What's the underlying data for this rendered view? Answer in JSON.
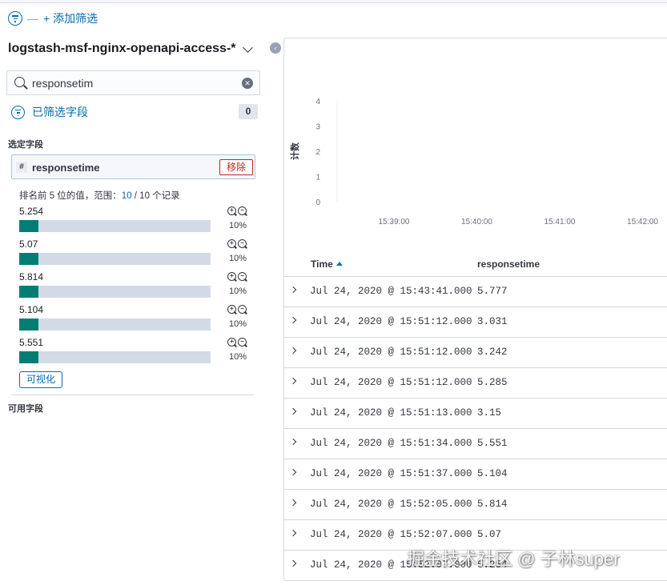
{
  "filter_bar": {
    "separator": "—",
    "add_filter": "+ 添加筛选"
  },
  "sidebar": {
    "index_pattern": "logstash-msf-nginx-openapi-access-*",
    "collapse_glyph": "‹",
    "search": {
      "value": "responsetim",
      "placeholder": ""
    },
    "filtered_fields_label": "已筛选字段",
    "filtered_fields_count": "0",
    "selected_fields_title": "选定字段",
    "available_fields_title": "可用字段",
    "selected_field": {
      "type_glyph": "#",
      "name": "responsetime",
      "remove_label": "移除",
      "details": {
        "summary_prefix": "排名前 5 位的值，范围：",
        "summary_count": "10",
        "summary_suffix": " / 10 个记录",
        "top_values": [
          {
            "value": "5.254",
            "percent": "10%",
            "fraction": 0.1
          },
          {
            "value": "5.07",
            "percent": "10%",
            "fraction": 0.1
          },
          {
            "value": "5.814",
            "percent": "10%",
            "fraction": 0.1
          },
          {
            "value": "5.104",
            "percent": "10%",
            "fraction": 0.1
          },
          {
            "value": "5.551",
            "percent": "10%",
            "fraction": 0.1
          }
        ],
        "visualize_label": "可视化"
      }
    }
  },
  "chart_data": {
    "type": "bar",
    "ylabel": "计数",
    "ylim": [
      0,
      4
    ],
    "y_ticks": [
      "0",
      "1",
      "2",
      "3",
      "4"
    ],
    "x_ticks": [
      "15:39:00",
      "15:40:00",
      "15:41:00",
      "15:42:00"
    ],
    "grid": false
  },
  "documents": {
    "columns": [
      "Time",
      "responsetime"
    ],
    "rows": [
      {
        "time": "Jul 24, 2020 @ 15:43:41.000",
        "responsetime": "5.777"
      },
      {
        "time": "Jul 24, 2020 @ 15:51:12.000",
        "responsetime": "3.031"
      },
      {
        "time": "Jul 24, 2020 @ 15:51:12.000",
        "responsetime": "3.242"
      },
      {
        "time": "Jul 24, 2020 @ 15:51:12.000",
        "responsetime": "5.285"
      },
      {
        "time": "Jul 24, 2020 @ 15:51:13.000",
        "responsetime": "3.15"
      },
      {
        "time": "Jul 24, 2020 @ 15:51:34.000",
        "responsetime": "5.551"
      },
      {
        "time": "Jul 24, 2020 @ 15:51:37.000",
        "responsetime": "5.104"
      },
      {
        "time": "Jul 24, 2020 @ 15:52:05.000",
        "responsetime": "5.814"
      },
      {
        "time": "Jul 24, 2020 @ 15:52:07.000",
        "responsetime": "5.07"
      },
      {
        "time": "Jul 24, 2020 @ 15:52:07.000",
        "responsetime": "5.254"
      }
    ]
  },
  "watermark": "掘金技术社区 @ 子林super",
  "colors": {
    "accent": "#006bb4",
    "bar_fill": "#017d73",
    "danger": "#bd271e"
  }
}
